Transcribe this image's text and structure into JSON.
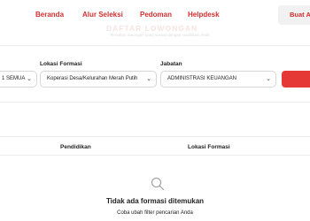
{
  "nav": {
    "links": [
      "Beranda",
      "Alur Seleksi",
      "Pedoman",
      "Helpdesk"
    ],
    "button_label": "Buat A"
  },
  "hero": {
    "title": "DAFTAR LOWONGAN",
    "subtitle": "Temukan lowongan yang sesuai dengan kualifikasi Anda"
  },
  "filters": {
    "first": {
      "value": "1 SEMUA"
    },
    "lokasi": {
      "label": "Lokasi Formasi",
      "value": "Koperasi Desa/Kelurahan Merah Putih"
    },
    "jabatan": {
      "label": "Jabatan",
      "value": "ADMINISTRASI KEUANGAN"
    }
  },
  "table": {
    "headers": [
      "Pendidikan",
      "Lokasi Formasi"
    ]
  },
  "empty_state": {
    "title": "Tidak ada formasi ditemukan",
    "hint": "Coba ubah filter pencarian Anda"
  },
  "colors": {
    "brand_red": "#d32f2f",
    "button_red": "#e53935"
  }
}
